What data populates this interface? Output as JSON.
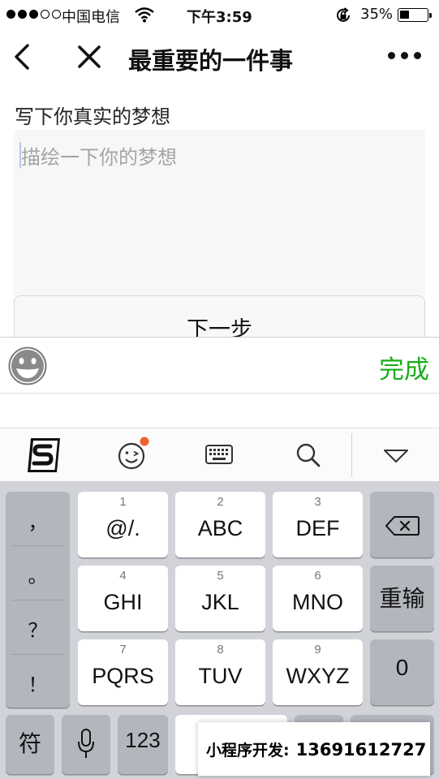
{
  "status_bar": {
    "carrier": "中国电信",
    "time": "下午3:59",
    "battery_percent": "35%",
    "battery_level": 0.35
  },
  "nav": {
    "title": "最重要的一件事"
  },
  "form": {
    "label": "写下你真实的梦想",
    "placeholder": "描绘一下你的梦想",
    "value": "",
    "next_label": "下一步"
  },
  "input_bar": {
    "done_label": "完成"
  },
  "keyboard": {
    "punctuation": [
      "，",
      "。",
      "？",
      "！"
    ],
    "keys": [
      {
        "num": "1",
        "label": "@/."
      },
      {
        "num": "2",
        "label": "ABC"
      },
      {
        "num": "3",
        "label": "DEF"
      },
      {
        "num": "4",
        "label": "GHI"
      },
      {
        "num": "5",
        "label": "JKL"
      },
      {
        "num": "6",
        "label": "MNO"
      },
      {
        "num": "7",
        "label": "PQRS"
      },
      {
        "num": "8",
        "label": "TUV"
      },
      {
        "num": "9",
        "label": "WXYZ"
      }
    ],
    "retype_label": "重输",
    "zero_label": "0",
    "symbol_label": "符",
    "numeric_label": "123"
  },
  "watermark": {
    "label": "小程序开发:",
    "phone": "13691612727"
  },
  "colors": {
    "accent_green": "#1aad19",
    "ime_badge": "#f0622d"
  }
}
